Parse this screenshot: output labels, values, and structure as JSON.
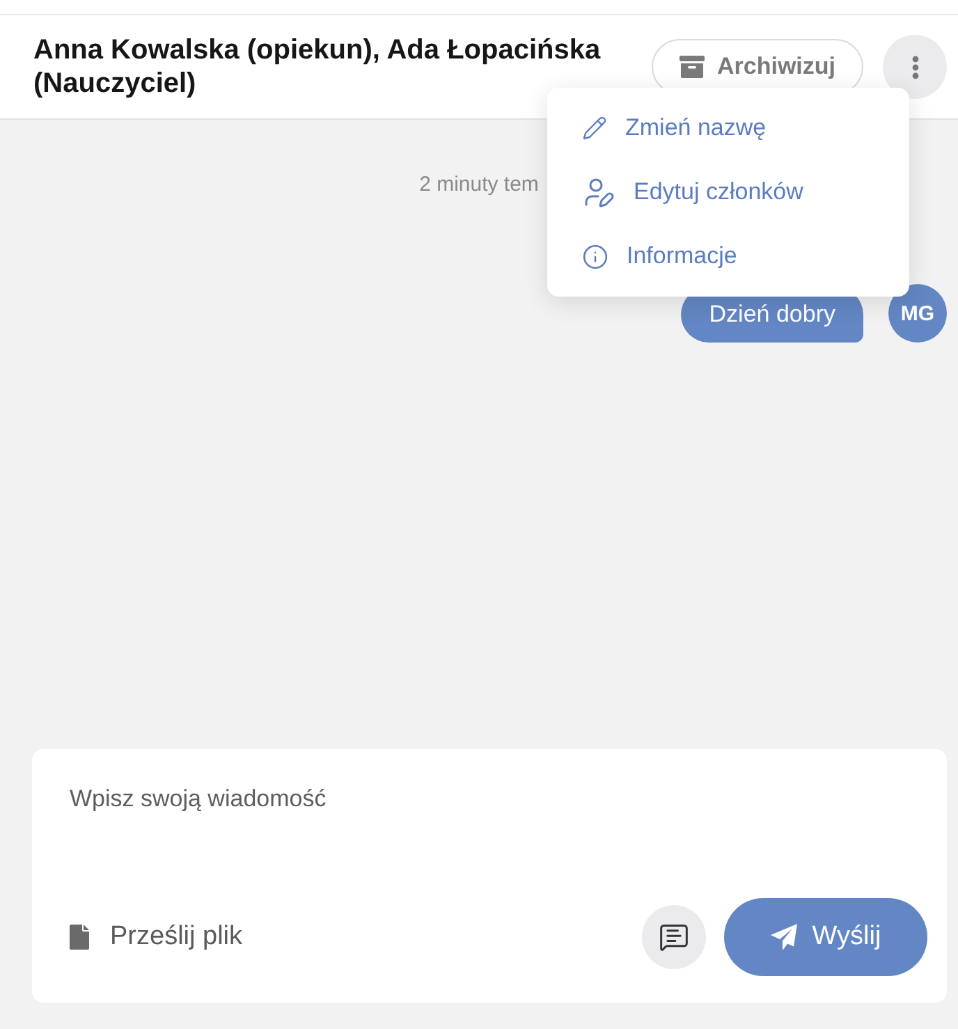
{
  "header": {
    "title": "Anna Kowalska (opiekun), Ada Łopacińska (Nauczyciel)",
    "archive_button": "Archiwizuj"
  },
  "menu": {
    "items": [
      {
        "kind": "rename",
        "label": "Zmień nazwę"
      },
      {
        "kind": "members",
        "label": "Edytuj członków"
      },
      {
        "kind": "info",
        "label": "Informacje"
      }
    ]
  },
  "conversation": {
    "timestamp": "2 minuty tem",
    "messages": [
      {
        "text": "Dzień dobry",
        "avatar": "MG",
        "outgoing": true
      }
    ]
  },
  "composer": {
    "placeholder": "Wpisz swoją wiadomość",
    "upload_label": "Prześlij plik",
    "send_button": "Wyślij"
  }
}
